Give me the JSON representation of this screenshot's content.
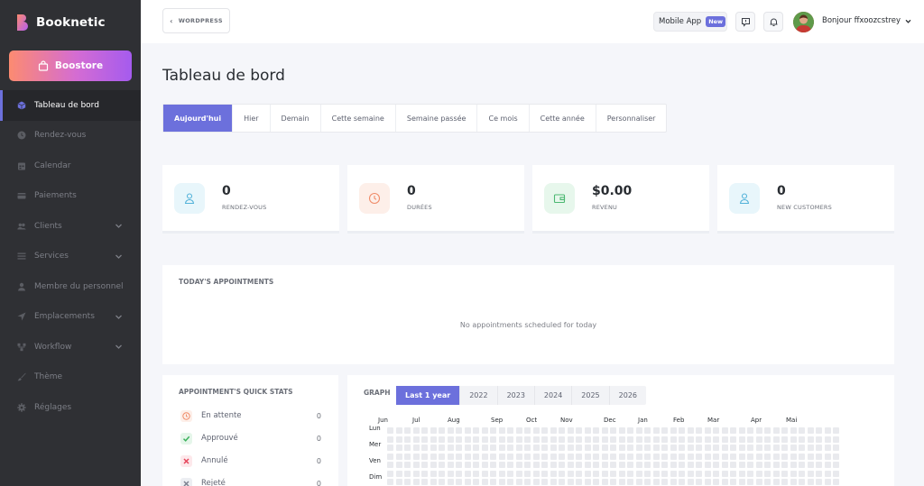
{
  "brand": {
    "name": "Booknetic",
    "accent": "#6c70dc"
  },
  "sidebar": {
    "boostore_label": "Boostore",
    "items": [
      {
        "label": "Tableau de bord",
        "icon": "cube-icon",
        "active": true,
        "has_submenu": false
      },
      {
        "label": "Rendez-vous",
        "icon": "clock-icon",
        "active": false,
        "has_submenu": false
      },
      {
        "label": "Calendar",
        "icon": "calendar-icon",
        "active": false,
        "has_submenu": false
      },
      {
        "label": "Paiements",
        "icon": "credit-card-icon",
        "active": false,
        "has_submenu": false
      },
      {
        "label": "Clients",
        "icon": "users-icon",
        "active": false,
        "has_submenu": true
      },
      {
        "label": "Services",
        "icon": "list-icon",
        "active": false,
        "has_submenu": true
      },
      {
        "label": "Membre du personnel",
        "icon": "user-icon",
        "active": false,
        "has_submenu": false
      },
      {
        "label": "Emplacements",
        "icon": "location-arrow-icon",
        "active": false,
        "has_submenu": true
      },
      {
        "label": "Workflow",
        "icon": "workflow-icon",
        "active": false,
        "has_submenu": true
      },
      {
        "label": "Thème",
        "icon": "brush-icon",
        "active": false,
        "has_submenu": false
      },
      {
        "label": "Réglages",
        "icon": "gear-icon",
        "active": false,
        "has_submenu": false
      }
    ]
  },
  "topbar": {
    "wordpress_label": "WORDPRESS",
    "mobile_app_label": "Mobile App",
    "new_badge": "New",
    "greeting": "Bonjour ffxoozcstrey"
  },
  "page": {
    "title": "Tableau de bord",
    "tabs": [
      "Aujourd'hui",
      "Hier",
      "Demain",
      "Cette semaine",
      "Semaine passée",
      "Ce mois",
      "Cette année",
      "Personnaliser"
    ],
    "active_tab": 0
  },
  "stats": [
    {
      "value": "0",
      "label": "RENDEZ-VOUS",
      "icon": "user-icon",
      "color": "#53b2d9",
      "bg": "#e8f6fb"
    },
    {
      "value": "0",
      "label": "DURÉES",
      "icon": "clock-icon",
      "color": "#f08c6a",
      "bg": "#fdefe9"
    },
    {
      "value": "$0.00",
      "label": "REVENU",
      "icon": "wallet-icon",
      "color": "#4cb872",
      "bg": "#e7f7ec"
    },
    {
      "value": "0",
      "label": "NEW CUSTOMERS",
      "icon": "user-icon",
      "color": "#53b2d9",
      "bg": "#e8f6fb"
    }
  ],
  "today_appointments": {
    "title": "TODAY'S APPOINTMENTS",
    "empty_text": "No appointments scheduled for today"
  },
  "quick_stats": {
    "title": "APPOINTMENT'S QUICK STATS",
    "rows": [
      {
        "label": "En attente",
        "count": "0",
        "icon": "clock-icon",
        "color": "#f08c6a",
        "bg": "#fdefe9"
      },
      {
        "label": "Approuvé",
        "count": "0",
        "icon": "check-icon",
        "color": "#3cb15d",
        "bg": "#e5f6ea"
      },
      {
        "label": "Annulé",
        "count": "0",
        "icon": "x-icon",
        "color": "#e6455a",
        "bg": "#fde8eb"
      },
      {
        "label": "Rejeté",
        "count": "0",
        "icon": "x-icon",
        "color": "#7d8190",
        "bg": "#eceef2"
      }
    ]
  },
  "graph": {
    "title": "GRAPH",
    "years": [
      "Last 1 year",
      "2022",
      "2023",
      "2024",
      "2025",
      "2026"
    ],
    "active_year": 0,
    "months": [
      "Jun",
      "Jul",
      "Aug",
      "Sep",
      "Oct",
      "Nov",
      "Dec",
      "Jan",
      "Feb",
      "Mar",
      "Apr",
      "Mai"
    ],
    "days": [
      "Lun",
      "Mer",
      "Ven",
      "Dim"
    ]
  }
}
